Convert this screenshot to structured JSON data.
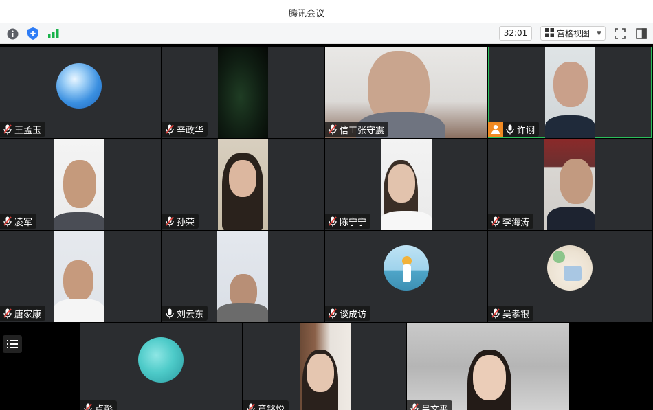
{
  "window": {
    "title": "腾讯会议"
  },
  "toolbar": {
    "timer": "32:01",
    "view_label": "宫格视图",
    "icons": [
      "info-icon",
      "shield-icon",
      "signal-icon",
      "fullscreen-icon",
      "sidebar-icon"
    ]
  },
  "participants": [
    {
      "name": "王孟玉",
      "muted": true
    },
    {
      "name": "辛政华",
      "muted": true
    },
    {
      "name": "信工张守震",
      "muted": true
    },
    {
      "name": "许诩",
      "muted": false,
      "host": true
    },
    {
      "name": "凌军",
      "muted": true
    },
    {
      "name": "孙荣",
      "muted": true
    },
    {
      "name": "陈宁宁",
      "muted": true
    },
    {
      "name": "李海涛",
      "muted": true
    },
    {
      "name": "唐家康",
      "muted": true
    },
    {
      "name": "刘云东",
      "muted": false
    },
    {
      "name": "谈成访",
      "muted": true
    },
    {
      "name": "吴孝银",
      "muted": true
    },
    {
      "name": "卢彰",
      "muted": true
    },
    {
      "name": "章铭悦",
      "muted": true
    },
    {
      "name": "吕文平",
      "muted": true
    }
  ],
  "colors": {
    "tile_bg": "#2b2d30",
    "active_border": "#2bbf5b",
    "host_badge": "#f18a22",
    "muted_mic": "#e0403a"
  }
}
